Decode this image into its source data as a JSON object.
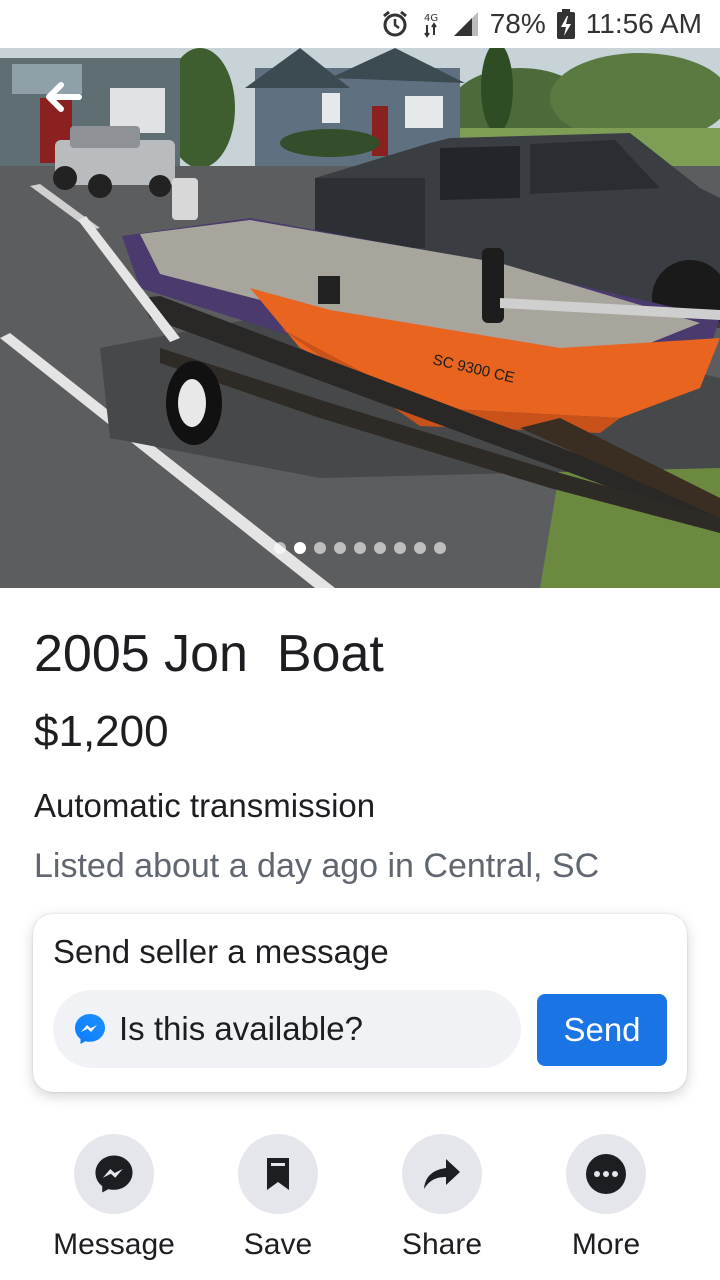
{
  "status_bar": {
    "alarm_icon": "alarm-clock-icon",
    "network_label": "4G",
    "battery_percent": "78%",
    "time": "11:56 AM"
  },
  "photo": {
    "slide_count": 9,
    "active_slide": 1,
    "back_icon": "arrow-left-icon",
    "plate_text": "SC 9300 CE"
  },
  "listing": {
    "title": "2005 Jon  Boat",
    "price": "$1,200",
    "attribute": "Automatic transmission",
    "listed": "Listed about a day ago in Central, SC"
  },
  "message_card": {
    "title": "Send seller a message",
    "input_value": "Is this available?",
    "send_label": "Send"
  },
  "actions": [
    {
      "label": "Message",
      "icon": "messenger-icon"
    },
    {
      "label": "Save",
      "icon": "bookmark-icon"
    },
    {
      "label": "Share",
      "icon": "share-arrow-icon"
    },
    {
      "label": "More",
      "icon": "more-dots-icon"
    }
  ],
  "colors": {
    "accent": "#1b74e4",
    "secondary_text": "#606770",
    "action_circle": "#e4e6eb",
    "boat_orange": "#e8641f"
  }
}
